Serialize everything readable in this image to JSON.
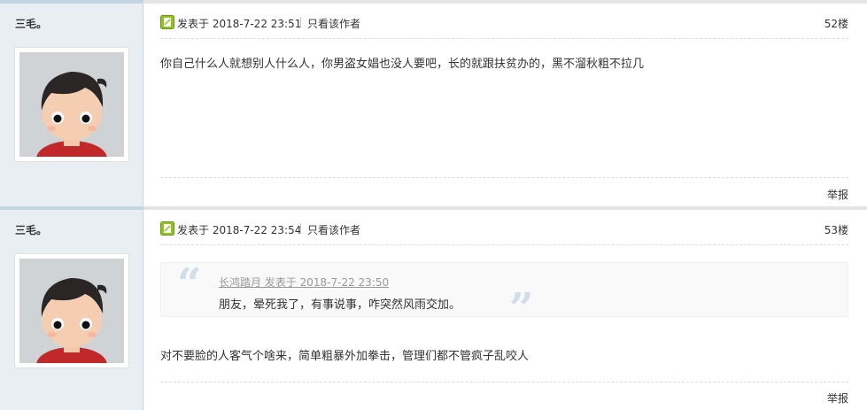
{
  "posts": [
    {
      "author": "三毛。",
      "posted_label": "发表于",
      "date": "2018-7-22 23:51",
      "only_author": "只看该作者",
      "floor": "52楼",
      "body": "你自己什么人就想别人什么人，你男盗女娼也没人要吧，长的就跟扶贫办的，黑不溜秋粗不拉几",
      "report": "举报"
    },
    {
      "author": "三毛。",
      "posted_label": "发表于",
      "date": "2018-7-22 23:54",
      "only_author": "只看该作者",
      "floor": "53楼",
      "quote": {
        "meta": "长鸿踏月 发表于 2018-7-22 23:50",
        "text": "朋友，晕死我了，有事说事，咋突然风雨交加。"
      },
      "body": "对不要脸的人客气个啥来，简单粗暴外加拳击，管理们都不管疯子乱咬人",
      "report": "举报"
    }
  ],
  "colors": {
    "sidebar_bg": "#e9eef2",
    "sidebar_border": "#c2d5e3",
    "quote_mark": "#cfdeea",
    "post_icon": "#8fc31f"
  },
  "icons": {
    "post_icon": "posted-doc-icon",
    "quote_open": "quote-open-icon",
    "quote_close": "quote-close-icon"
  }
}
